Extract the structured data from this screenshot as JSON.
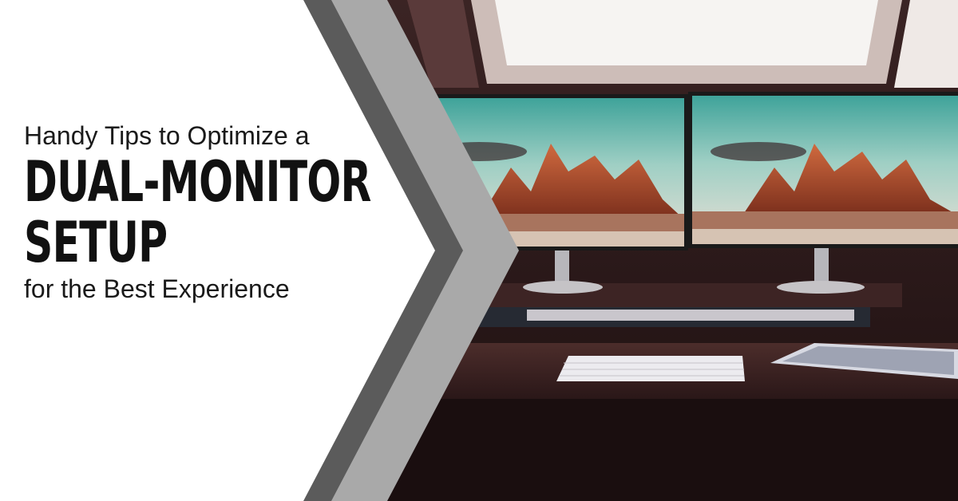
{
  "headline": {
    "line1": "Handy Tips to Optimize a",
    "line2": "DUAL-MONITOR",
    "line3": "SETUP",
    "line4": "for the Best Experience"
  },
  "colors": {
    "chevron_outer": "#5b5b5b",
    "chevron_inner": "#a9a9a9",
    "background": "#ffffff",
    "room_dark": "#2a1414"
  },
  "illustration": {
    "subject": "dual-monitor-desk-photo"
  }
}
